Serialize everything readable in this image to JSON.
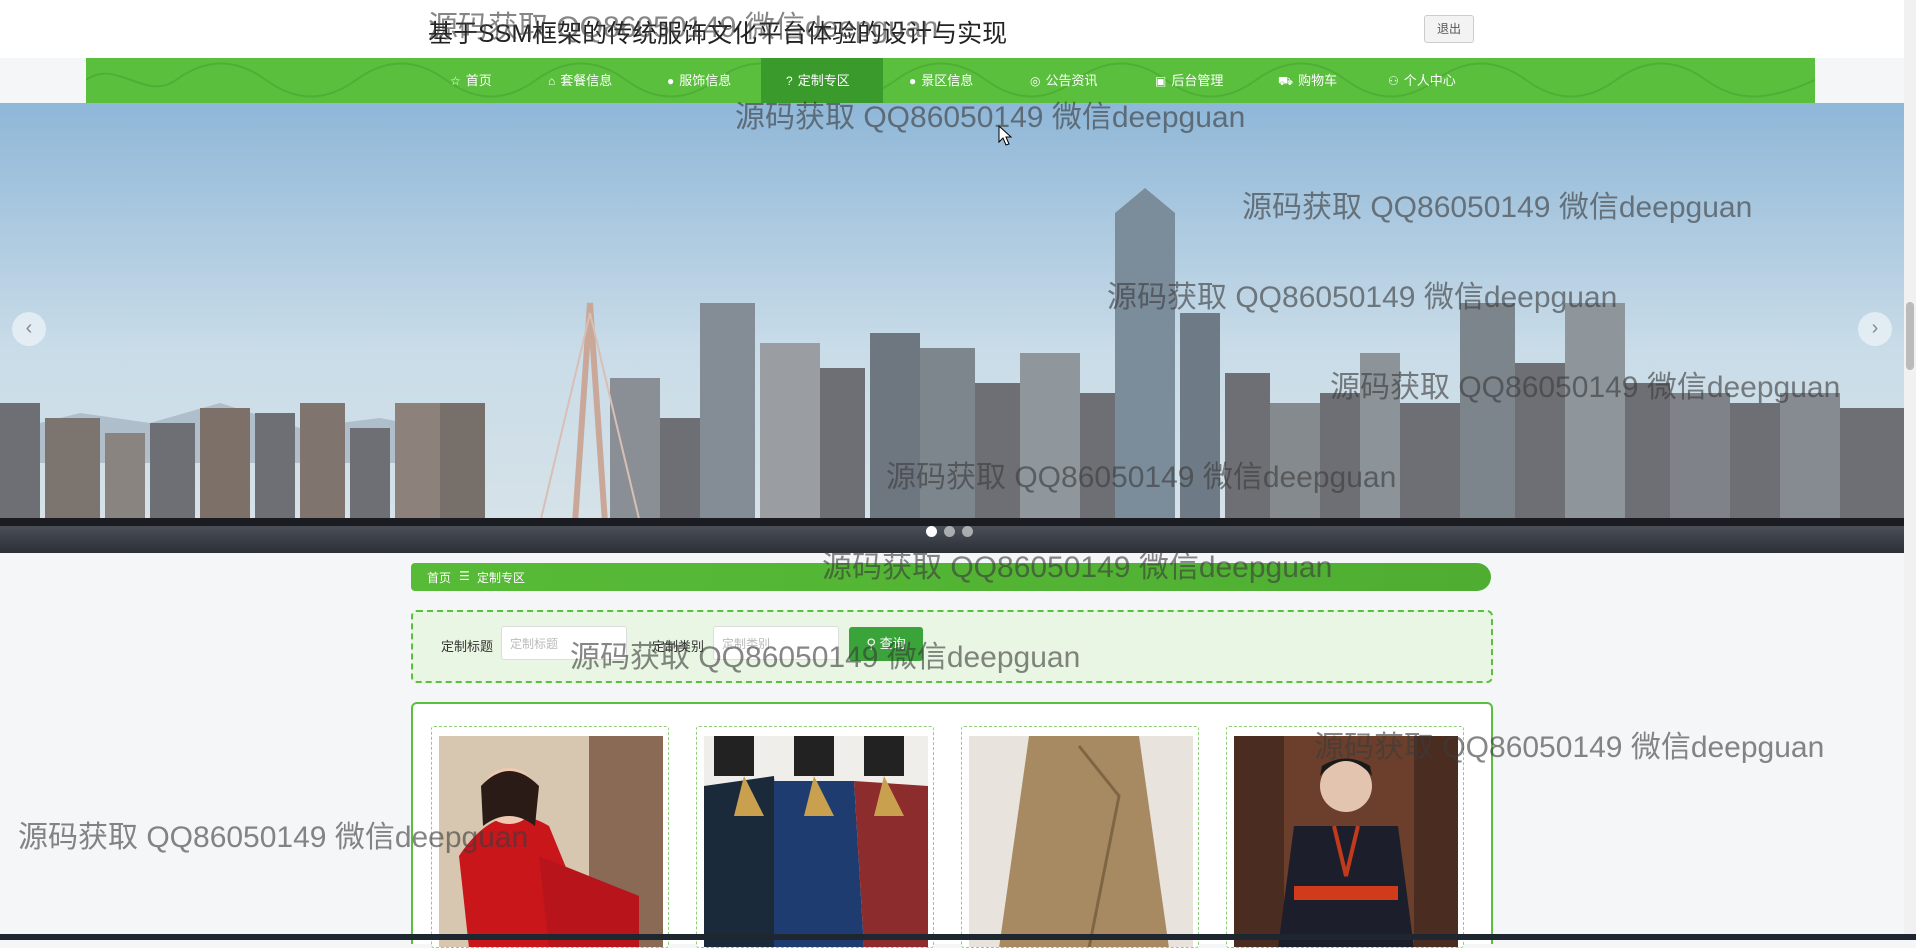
{
  "header": {
    "title": "基于SSM框架的传统服饰文化平台体验的设计与实现",
    "logout_label": "退出"
  },
  "nav": {
    "items": [
      {
        "label": "首页",
        "icon": "star-icon"
      },
      {
        "label": "套餐信息",
        "icon": "bag-icon"
      },
      {
        "label": "服饰信息",
        "icon": "info-icon"
      },
      {
        "label": "定制专区",
        "icon": "question-icon",
        "active": true
      },
      {
        "label": "景区信息",
        "icon": "info-icon"
      },
      {
        "label": "公告资讯",
        "icon": "globe-icon"
      },
      {
        "label": "后台管理",
        "icon": "gift-icon"
      },
      {
        "label": "购物车",
        "icon": "cart-icon"
      },
      {
        "label": "个人中心",
        "icon": "user-icon"
      }
    ]
  },
  "banner": {
    "prev_icon": "‹",
    "next_icon": "›",
    "slide_count": 3,
    "active_slide": 1
  },
  "breadcrumb": {
    "home": "首页",
    "separator": "☰",
    "current": "定制专区"
  },
  "search": {
    "title_label": "定制标题",
    "title_placeholder": "定制标题",
    "type_label": "定制类别",
    "type_placeholder": "定制类别",
    "button_label": "查询"
  },
  "watermark": "源码获取 QQ86050149 微信deepguan",
  "colors": {
    "brand_green": "#5bbf3e",
    "active_green": "#3a9a2b"
  }
}
